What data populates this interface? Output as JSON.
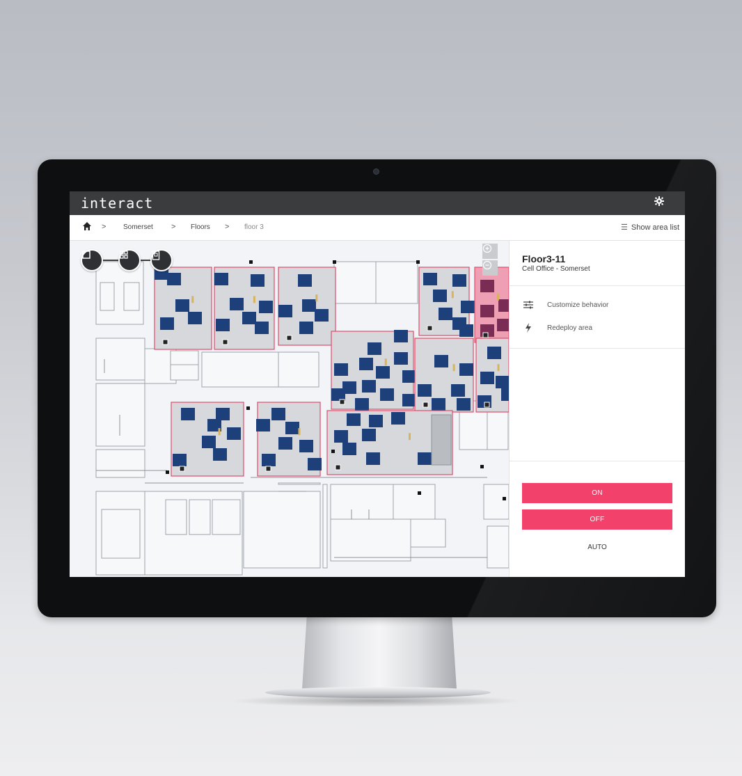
{
  "app": {
    "logo": "interact",
    "settings_icon": "gear-icon"
  },
  "breadcrumb": {
    "home_icon": "home-icon",
    "items": [
      "Somerset",
      "Floors",
      "floor 3"
    ],
    "separator": ">"
  },
  "header": {
    "show_area_list": "Show area list",
    "list_icon": "list-icon"
  },
  "map": {
    "tools": [
      "area-select-icon",
      "grid-icon",
      "device-icon"
    ],
    "zoom": [
      "zoom-in-icon",
      "zoom-out-icon"
    ]
  },
  "panel": {
    "title": "Floor3-11",
    "subtitle": "Cell Office - Somerset",
    "actions": [
      {
        "icon": "sliders-icon",
        "label": "Customize behavior"
      },
      {
        "icon": "bolt-icon",
        "label": "Redeploy area"
      }
    ],
    "on_label": "ON",
    "off_label": "OFF",
    "auto_label": "AUTO"
  },
  "colors": {
    "accent": "#f2416a",
    "topbar": "#3b3c3e",
    "desk": "#1d3f7a",
    "area_outline": "#e04b6a",
    "area_fill": "#d6d8dc"
  }
}
